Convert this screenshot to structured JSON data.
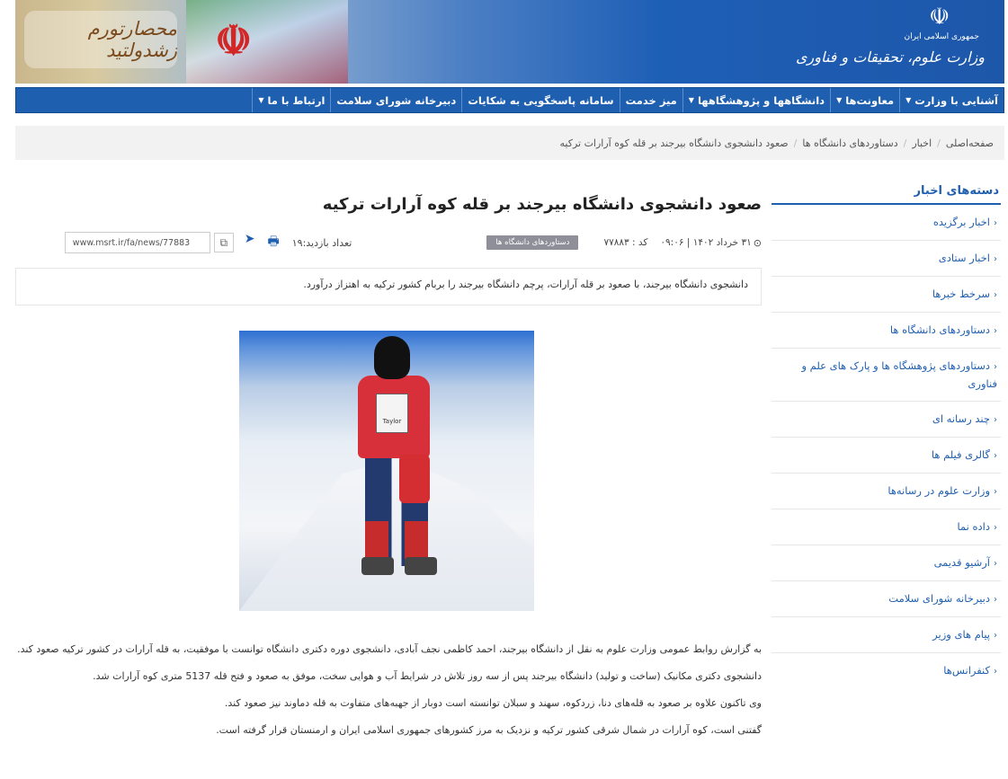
{
  "header": {
    "calligraphy": "محصارتورم زشدولتید",
    "emblem": "☫",
    "brand_small": "جمهوری اسلامی ایران",
    "brand_name": "وزارت علوم، تحقیقات و فناوری"
  },
  "nav": {
    "items": [
      {
        "label": "آشنایی با وزارت",
        "dropdown": true
      },
      {
        "label": "معاونت‌ها",
        "dropdown": true
      },
      {
        "label": "دانشگاهها و پژوهشگاهها",
        "dropdown": true
      },
      {
        "label": "میز خدمت",
        "dropdown": false
      },
      {
        "label": "سامانه پاسخگویی به شکایات",
        "dropdown": false
      },
      {
        "label": "دبیرخانه شورای سلامت",
        "dropdown": false
      },
      {
        "label": "ارتباط با ما",
        "dropdown": true
      }
    ]
  },
  "breadcrumb": {
    "items": [
      "صفحه‌اصلی",
      "اخبار",
      "دستاوردهای دانشگاه ها",
      "صعود دانشجوی دانشگاه بیرجند بر قله کوه آرارات ترکیه"
    ]
  },
  "sidebar": {
    "title": "دسته‌های اخبار",
    "items": [
      "اخبار برگزیده",
      "اخبار ستادی",
      "سرخط خبرها",
      "دستاوردهای دانشگاه ها",
      "دستاوردهای پژوهشگاه ها و پارک های علم و فناوری",
      "چند رسانه ای",
      "گالری فیلم ها",
      "وزارت علوم در رسانه‌ها",
      "داده نما",
      "آرشیو قدیمی",
      "دبیرخانه شورای سلامت",
      "پیام های وزیر",
      "کنفرانس‌ها"
    ]
  },
  "article": {
    "title": "صعود دانشجوی دانشگاه بیرجند بر قله کوه آرارات ترکیه",
    "date": "۳۱ خرداد ۱۴۰۲ | ۰۹:۰۶",
    "code": "کد : ۷۷۸۸۳",
    "category_badge": "دستاوردهای دانشگاه ها",
    "visits": "تعداد بازدید:۱۹",
    "url": "www.msrt.ir/fa/news/77883",
    "lead": "دانشجوی دانشگاه بیرجند، با صعود بر قله آرارات، پرچم دانشگاه بیرجند را بربام کشور ترکیه به اهتزاز درآورد.",
    "paragraphs": [
      "به گزارش روابط عمومی وزارت علوم به نقل از دانشگاه بیرجند، احمد کاظمی نجف آبادی، دانشجوی دوره دکتری دانشگاه توانست با موفقیت، به قله آرارات در کشور ترکیه صعود کند.",
      "دانشجوی دکتری مکانیک (ساخت و تولید) دانشگاه بیرجند پس از سه روز تلاش در شرایط آب و هوایی سخت، موفق به صعود و فتح قله 5137 متری کوه آرارات شد.",
      "وی تاکنون علاوه بر صعود به قله‌های دنا، زردکوه، سهند و سبلان توانسته است دوبار از جهبه‌های متفاوت به قله دماوند نیز صعود کند.",
      "گفتنی است، کوه آرارات در شمال شرقی کشور ترکیه و نزدیک به مرز کشورهای جمهوری اسلامی ایران و ارمنستان قرار گرفته است."
    ],
    "photo_sign_text": "Taylor"
  }
}
